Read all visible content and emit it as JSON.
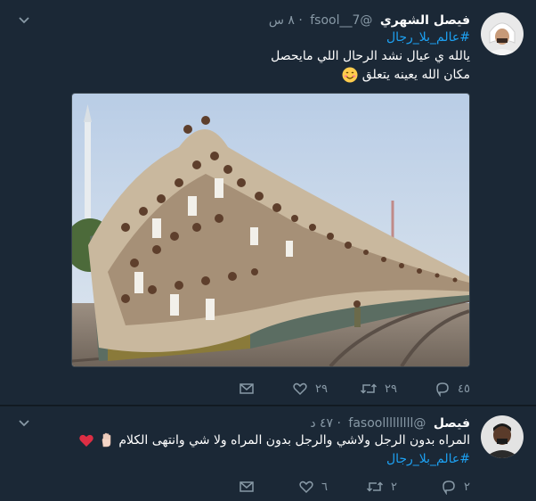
{
  "tweets": [
    {
      "name": "فيصل الشهري",
      "handle": "@fsool__7",
      "time": "٨ س",
      "hashtag": "#عالم_بلا_رجال",
      "line1": "يالله ي عيال نشد الرحال اللي مايحصل",
      "line2": "مكان الله يعينه  يتعلق",
      "emoji": "smiling-face-emoji",
      "photo": "crowded-train-photo",
      "replies": "٤٥",
      "retweets": "٢٩",
      "likes": "٢٩"
    },
    {
      "name": "فيصل",
      "handle": "@fasoolllllllll",
      "time": "٤٧ د",
      "line1": "المراه بدون الرجل ولاشي والرجل بدون المراه ولا شي وانتهى الكلام",
      "emoji": "raised-hand-and-heart-emoji",
      "hashtag": "#عالم_بلا_رجال",
      "replies": "٢",
      "retweets": "٢",
      "likes": "٦"
    }
  ],
  "colors": {
    "background": "#141d26",
    "card": "#1b2836",
    "accent": "#1da1f2",
    "muted": "#8899a6"
  }
}
